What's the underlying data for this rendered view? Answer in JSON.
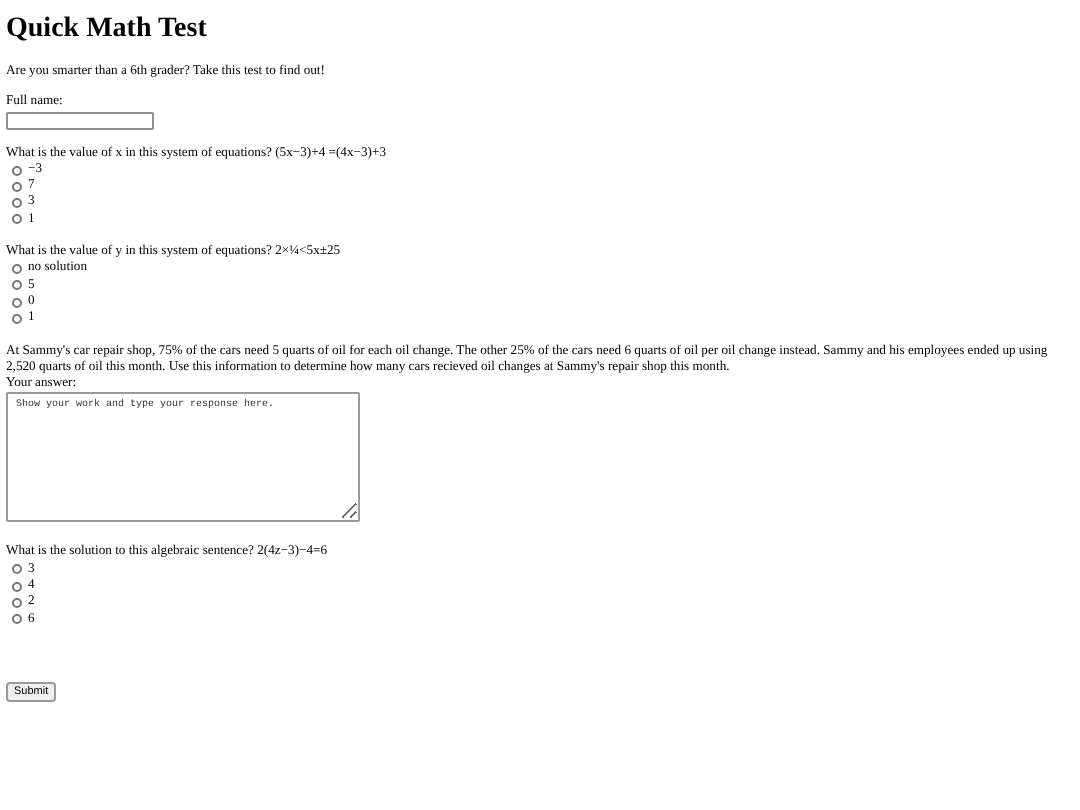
{
  "title": "Quick Math Test",
  "intro": "Are you smarter than a 6th grader? Take this test to find out!",
  "name_field": {
    "label": "Full name:"
  },
  "questions": [
    {
      "kind": "radio",
      "prompt": "What is the value of x in this system of equations? (5x−3)+4 =(4x−3)+3",
      "options": [
        {
          "label": "−3",
          "selected": false
        },
        {
          "label": "7",
          "selected": false
        },
        {
          "label": "3",
          "selected": false
        },
        {
          "label": "1",
          "selected": false
        }
      ]
    },
    {
      "kind": "radio",
      "prompt": "What is the value of y in this system of equations? 2×¼<5x±25",
      "options": [
        {
          "label": "no solution",
          "selected": false
        },
        {
          "label": "5",
          "selected": false
        },
        {
          "label": "0",
          "selected": false
        },
        {
          "label": "1",
          "selected": false
        }
      ]
    },
    {
      "kind": "text",
      "prompt": "At Sammy's car repair shop, 75% of the cars need 5 quarts of oil for each oil change. The other 25% of the cars need 6 quarts of oil per oil change instead. Sammy and his employees ended up using 2,520 quarts of oil this month. Use this information to determine how many cars recieved oil changes at Sammy's repair shop this month.",
      "label": "Your answer:",
      "placeholder": "Show your work and type your response here."
    },
    {
      "kind": "radio",
      "prompt": "What is the solution to this algebraic sentence? 2(4z−3)−4=6",
      "options": [
        {
          "label": "3",
          "selected": false
        },
        {
          "label": "4",
          "selected": false
        },
        {
          "label": "2",
          "selected": false
        },
        {
          "label": "6",
          "selected": false
        }
      ]
    }
  ],
  "submit": "Submit"
}
